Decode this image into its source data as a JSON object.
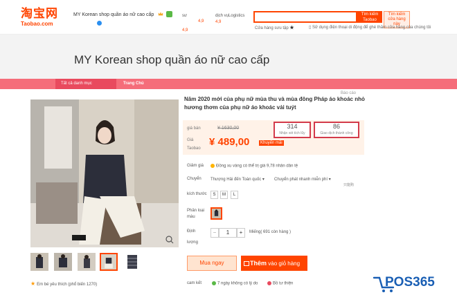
{
  "header": {
    "logo_main": "淘宝网",
    "logo_sub": "Taobao.com",
    "shop_name": "MY Korean shop quần áo nữ cao cấp",
    "ratings": [
      {
        "label": "sư",
        "value": "4,9"
      },
      {
        "label": "dịch vụ",
        "value": "4,9"
      },
      {
        "label": "Logistics",
        "value": "4,9"
      }
    ],
    "search_placeholder": "",
    "search_taobao_label": "Tìm kiếm Taobao",
    "search_shop_label": "Tìm kiếm cửa hàng này",
    "hot_label": "Cửa hàng sưu tập",
    "mobile_tip": "Sử dụng điện thoại di động để ghé thăm cửa hàng của chúng tôi"
  },
  "banner": {
    "title": "MY Korean shop quần áo nữ cao cấp"
  },
  "nav": {
    "all_categories": "Tất cả danh mục",
    "home": "Trang Chủ"
  },
  "product": {
    "report": "Báo cáo",
    "title": "Năm 2020 mới của phụ nữ mùa thu và mùa đông Pháp áo khoác nhỏ hương thơm của phụ nữ áo khoác vải tuýt",
    "original_price_label": "giá bán",
    "original_price": "¥ 1630,00",
    "price_label_1": "Giá",
    "price_label_2": "Taobao",
    "price": "¥ 489,00",
    "discount_tag": "Khuyến mãi",
    "stats": [
      {
        "num": "314",
        "label": "Nhận xét tích lũy"
      },
      {
        "num": "86",
        "label": "Giao dịch thành công"
      }
    ],
    "coin_label": "Giảm giá",
    "coin_text": "Đồng xu vàng có thể trị giá 9,78 nhân dân tệ",
    "shipping_label": "Chuyển",
    "shipping_from": "Thượng Hải đến Toàn quốc",
    "shipping_method": "Chuyển phát nhanh miễn phí",
    "shipping_time": "只能购",
    "size_label": "kích thước",
    "sizes": [
      "S",
      "M",
      "L"
    ],
    "color_label_1": "Phân loại",
    "color_label_2": "màu",
    "qty_label_1": "Định",
    "qty_label_2": "lượng",
    "qty_value": "1",
    "stock": "Miếng( 691 còn hàng )",
    "buy_now": "Mua ngay",
    "add_cart_big": "Thêm",
    "add_cart_rest": "vào giỏ hàng",
    "commit_label": "cam kết",
    "commit_1": "7 ngày không có lý do",
    "commit_2": "Bồ tư thiện",
    "favorites": "Em bé yêu thích (phổ biến 1270)"
  },
  "watermark": {
    "text": "POS365"
  },
  "colors": {
    "brand": "#ff4400",
    "nav": "#f56d7a",
    "stat_border": "#d33a4a"
  },
  "icons": [
    "crown-icon",
    "star-icon",
    "coin-icon",
    "cart-icon",
    "zoom-icon"
  ]
}
